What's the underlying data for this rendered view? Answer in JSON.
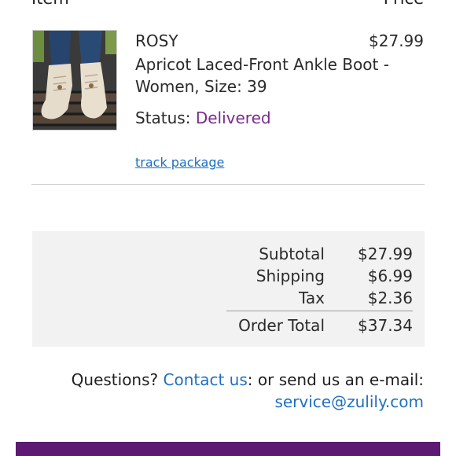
{
  "header": {
    "item_label": "Item",
    "price_label": "Price"
  },
  "order_item": {
    "brand": "ROSY",
    "price": "$27.99",
    "name": "Apricot Laced-Front Ankle Boot - Women, Size: 39",
    "status_label": "Status:",
    "status_value": "Delivered",
    "track_label": "track package"
  },
  "totals": {
    "subtotal_label": "Subtotal",
    "subtotal_value": "$27.99",
    "shipping_label": "Shipping",
    "shipping_value": "$6.99",
    "tax_label": "Tax",
    "tax_value": "$2.36",
    "order_total_label": "Order Total",
    "order_total_value": "$37.34"
  },
  "contact": {
    "questions": "Questions?",
    "contact_link": "Contact us",
    "middle": ": or send us an e-mail:",
    "email": "service@zulily.com"
  },
  "colors": {
    "link": "#1f6fbf",
    "delivered": "#7a2a8c",
    "footer": "#5c1a72"
  }
}
